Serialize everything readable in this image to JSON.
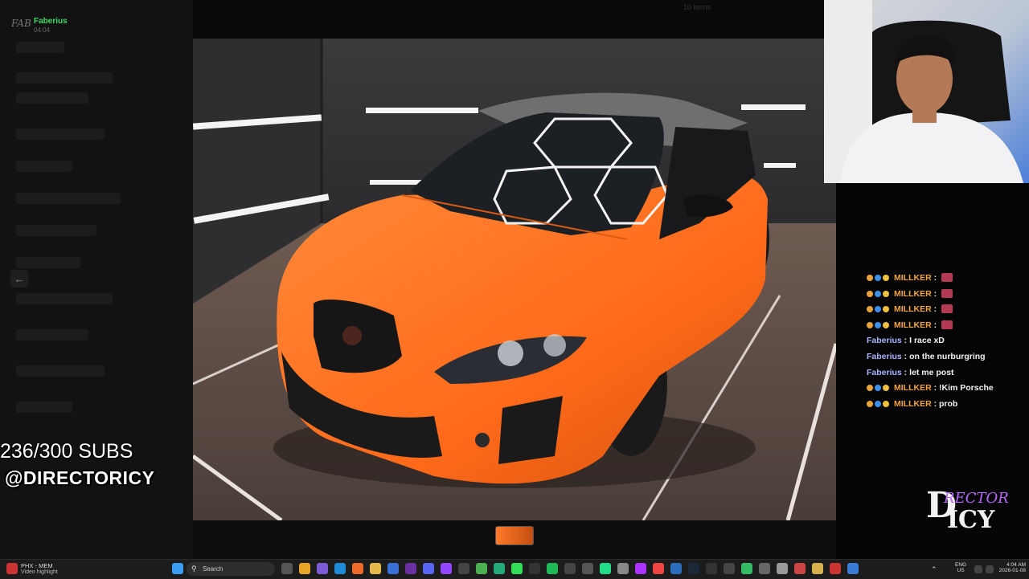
{
  "sidebar": {
    "logo": "FAB",
    "user_name": "Faberius",
    "user_time": "04:04"
  },
  "viewer": {
    "title": "10 items"
  },
  "overlay": {
    "subs": "236/300 SUBS",
    "handle": "@DIRECTORICY",
    "logo_top": "D",
    "logo_mid": "RECTOR",
    "logo_bottom": "ICY"
  },
  "chat": [
    {
      "user": "MILLKER",
      "message": "",
      "badges": true,
      "emote": true,
      "color": "#f1a43a"
    },
    {
      "user": "MILLKER",
      "message": "",
      "badges": true,
      "emote": true,
      "color": "#f1a43a"
    },
    {
      "user": "MILLKER",
      "message": "",
      "badges": true,
      "emote": true,
      "color": "#f1a43a"
    },
    {
      "user": "MILLKER",
      "message": "",
      "badges": true,
      "emote": true,
      "color": "#f1a43a"
    },
    {
      "user": "Faberius",
      "message": "I race xD",
      "badges": false,
      "emote": false,
      "color": "#aab4ff"
    },
    {
      "user": "Faberius",
      "message": "on the nurburgring",
      "badges": false,
      "emote": false,
      "color": "#aab4ff"
    },
    {
      "user": "Faberius",
      "message": "let me post",
      "badges": false,
      "emote": false,
      "color": "#aab4ff"
    },
    {
      "user": "MILLKER",
      "message": "!Kim Porsche",
      "badges": true,
      "emote": false,
      "color": "#f1a43a"
    },
    {
      "user": "MILLKER",
      "message": "prob",
      "badges": true,
      "emote": false,
      "color": "#f1a43a"
    }
  ],
  "taskbar": {
    "app_title": "PHX - MEM",
    "app_sub": "Video highlight",
    "search_label": "Search",
    "lang_top": "ENG",
    "lang_bottom": "US",
    "time": "4:04 AM",
    "date": "2026-01-08"
  },
  "colors": {
    "accent_green": "#3ddc68",
    "car_orange": "#ff6a1a",
    "chat_millker": "#f1a43a",
    "chat_faberius": "#aab4ff"
  }
}
